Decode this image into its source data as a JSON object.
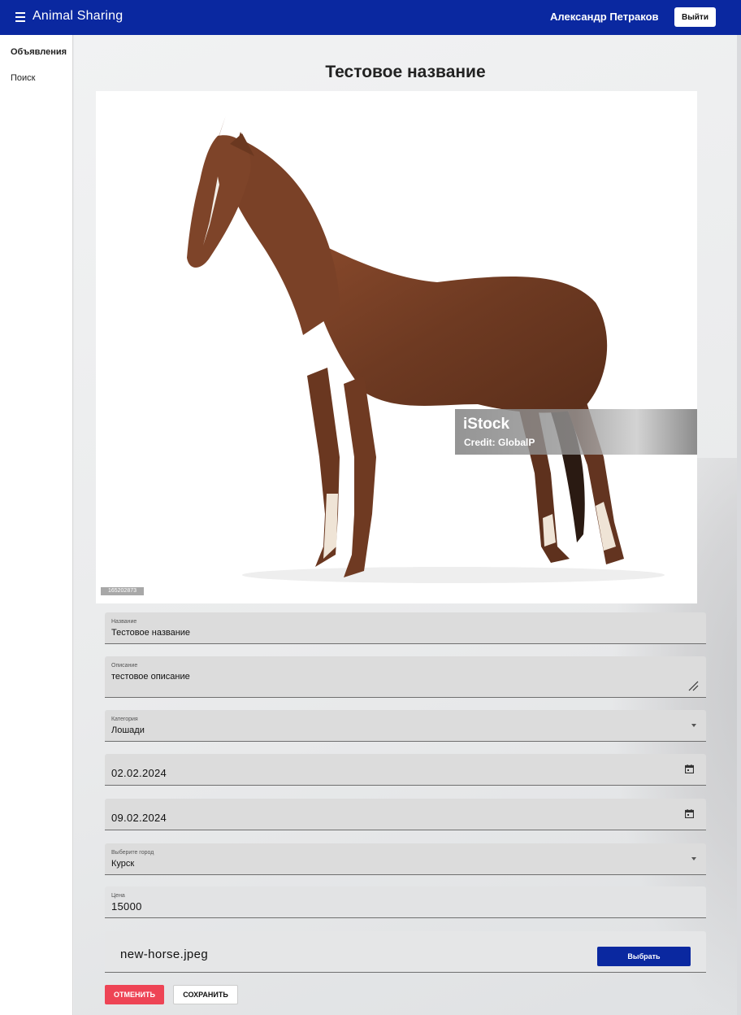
{
  "header": {
    "app_title": "Animal Sharing",
    "user_name": "Александр Петраков",
    "logout_label": "Выйти"
  },
  "sidebar": {
    "items": [
      {
        "label": "Объявления"
      },
      {
        "label": "Поиск"
      }
    ]
  },
  "page": {
    "title": "Тестовое название"
  },
  "photo": {
    "stock_id": "165202873",
    "watermark_brand": "iStock",
    "watermark_credit": "Credit: GlobalP"
  },
  "form": {
    "name": {
      "label": "Название",
      "value": "Тестовое название"
    },
    "description": {
      "label": "Описание",
      "value": "тестовое описание"
    },
    "category": {
      "label": "Категория",
      "value": "Лошади"
    },
    "date_from": {
      "value": "02.02.2024"
    },
    "date_to": {
      "value": "09.02.2024"
    },
    "city": {
      "label": "Выберите город",
      "value": "Курск"
    },
    "price": {
      "label": "Цена",
      "value": "15000"
    },
    "file": {
      "name": "new-horse.jpeg",
      "choose_label": "Выбрать"
    }
  },
  "actions": {
    "cancel_label": "ОТМЕНИТЬ",
    "save_label": "СОХРАНИТЬ"
  },
  "colors": {
    "brand": "#0a28a0",
    "danger": "#ee4455"
  }
}
